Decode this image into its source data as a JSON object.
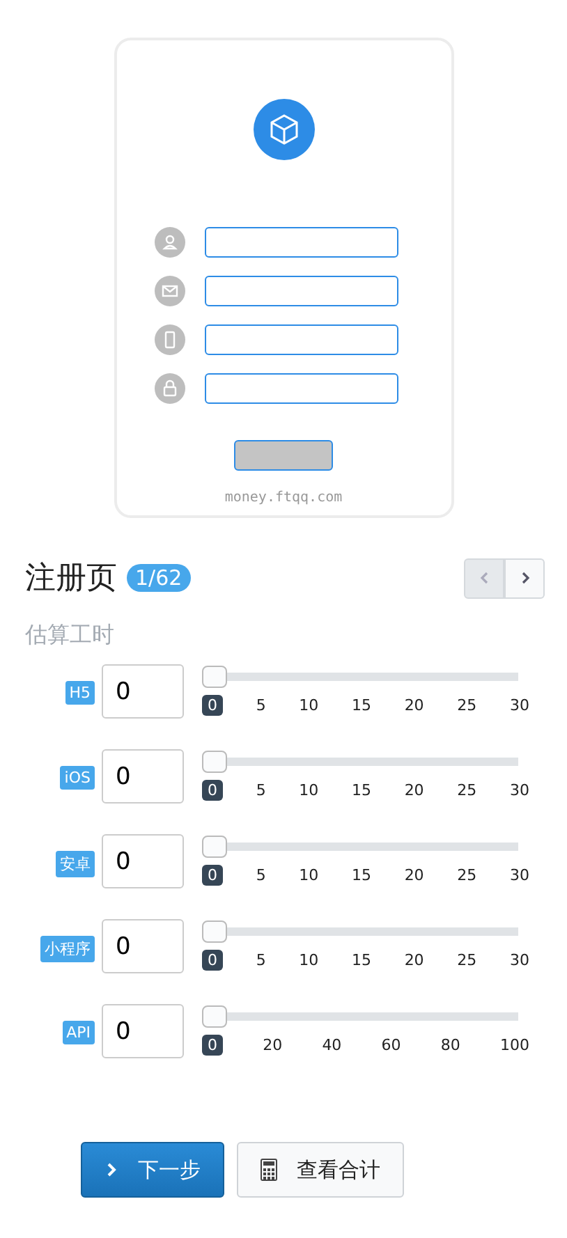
{
  "preview": {
    "fields": [
      {
        "kind": "user"
      },
      {
        "kind": "mail"
      },
      {
        "kind": "phone"
      },
      {
        "kind": "lock"
      }
    ],
    "footer": "money.ftqq.com"
  },
  "header": {
    "title": "注册页",
    "counter": "1/62",
    "prev_disabled": true
  },
  "section_title": "估算工时",
  "estimates": [
    {
      "label": "H5",
      "value": "0",
      "level": 0,
      "bubble": "0",
      "ticks": [
        "5",
        "10",
        "15",
        "20",
        "25",
        "30"
      ]
    },
    {
      "label": "iOS",
      "value": "0",
      "level": 0,
      "bubble": "0",
      "ticks": [
        "5",
        "10",
        "15",
        "20",
        "25",
        "30"
      ]
    },
    {
      "label": "安卓",
      "value": "0",
      "level": 0,
      "bubble": "0",
      "ticks": [
        "5",
        "10",
        "15",
        "20",
        "25",
        "30"
      ]
    },
    {
      "label": "小程序",
      "value": "0",
      "level": 0,
      "bubble": "0",
      "ticks": [
        "5",
        "10",
        "15",
        "20",
        "25",
        "30"
      ]
    },
    {
      "label": "API",
      "value": "0",
      "level": 0,
      "bubble": "0",
      "ticks": [
        "20",
        "40",
        "60",
        "80",
        "100"
      ]
    }
  ],
  "buttons": [
    {
      "kind": "primary",
      "label": "下一步"
    },
    {
      "kind": "secondary",
      "label": "查看合计"
    }
  ]
}
